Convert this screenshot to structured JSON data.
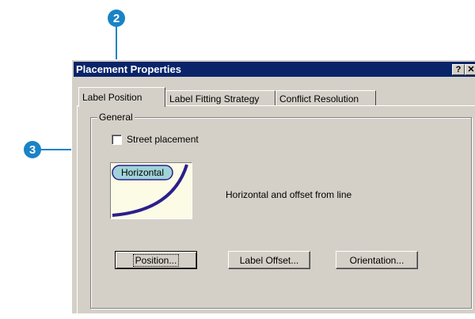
{
  "callouts": {
    "two": "2",
    "three": "3"
  },
  "dialog": {
    "title": "Placement Properties",
    "help_button": "?",
    "close_button": "✕"
  },
  "tabs": [
    {
      "label": "Label Position"
    },
    {
      "label": "Label Fitting Strategy"
    },
    {
      "label": "Conflict Resolution"
    }
  ],
  "general": {
    "group_label": "General",
    "street_placement_label": "Street placement",
    "street_placement_checked": false,
    "preview_label": "Horizontal",
    "description": "Horizontal and offset from line"
  },
  "buttons": {
    "position": "Position...",
    "label_offset": "Label Offset...",
    "orientation": "Orientation..."
  },
  "colors": {
    "callout": "#1a83c6",
    "titlebar": "#0a246a",
    "curve": "#2b1f8c",
    "preview_label": "#9fd3d8"
  }
}
